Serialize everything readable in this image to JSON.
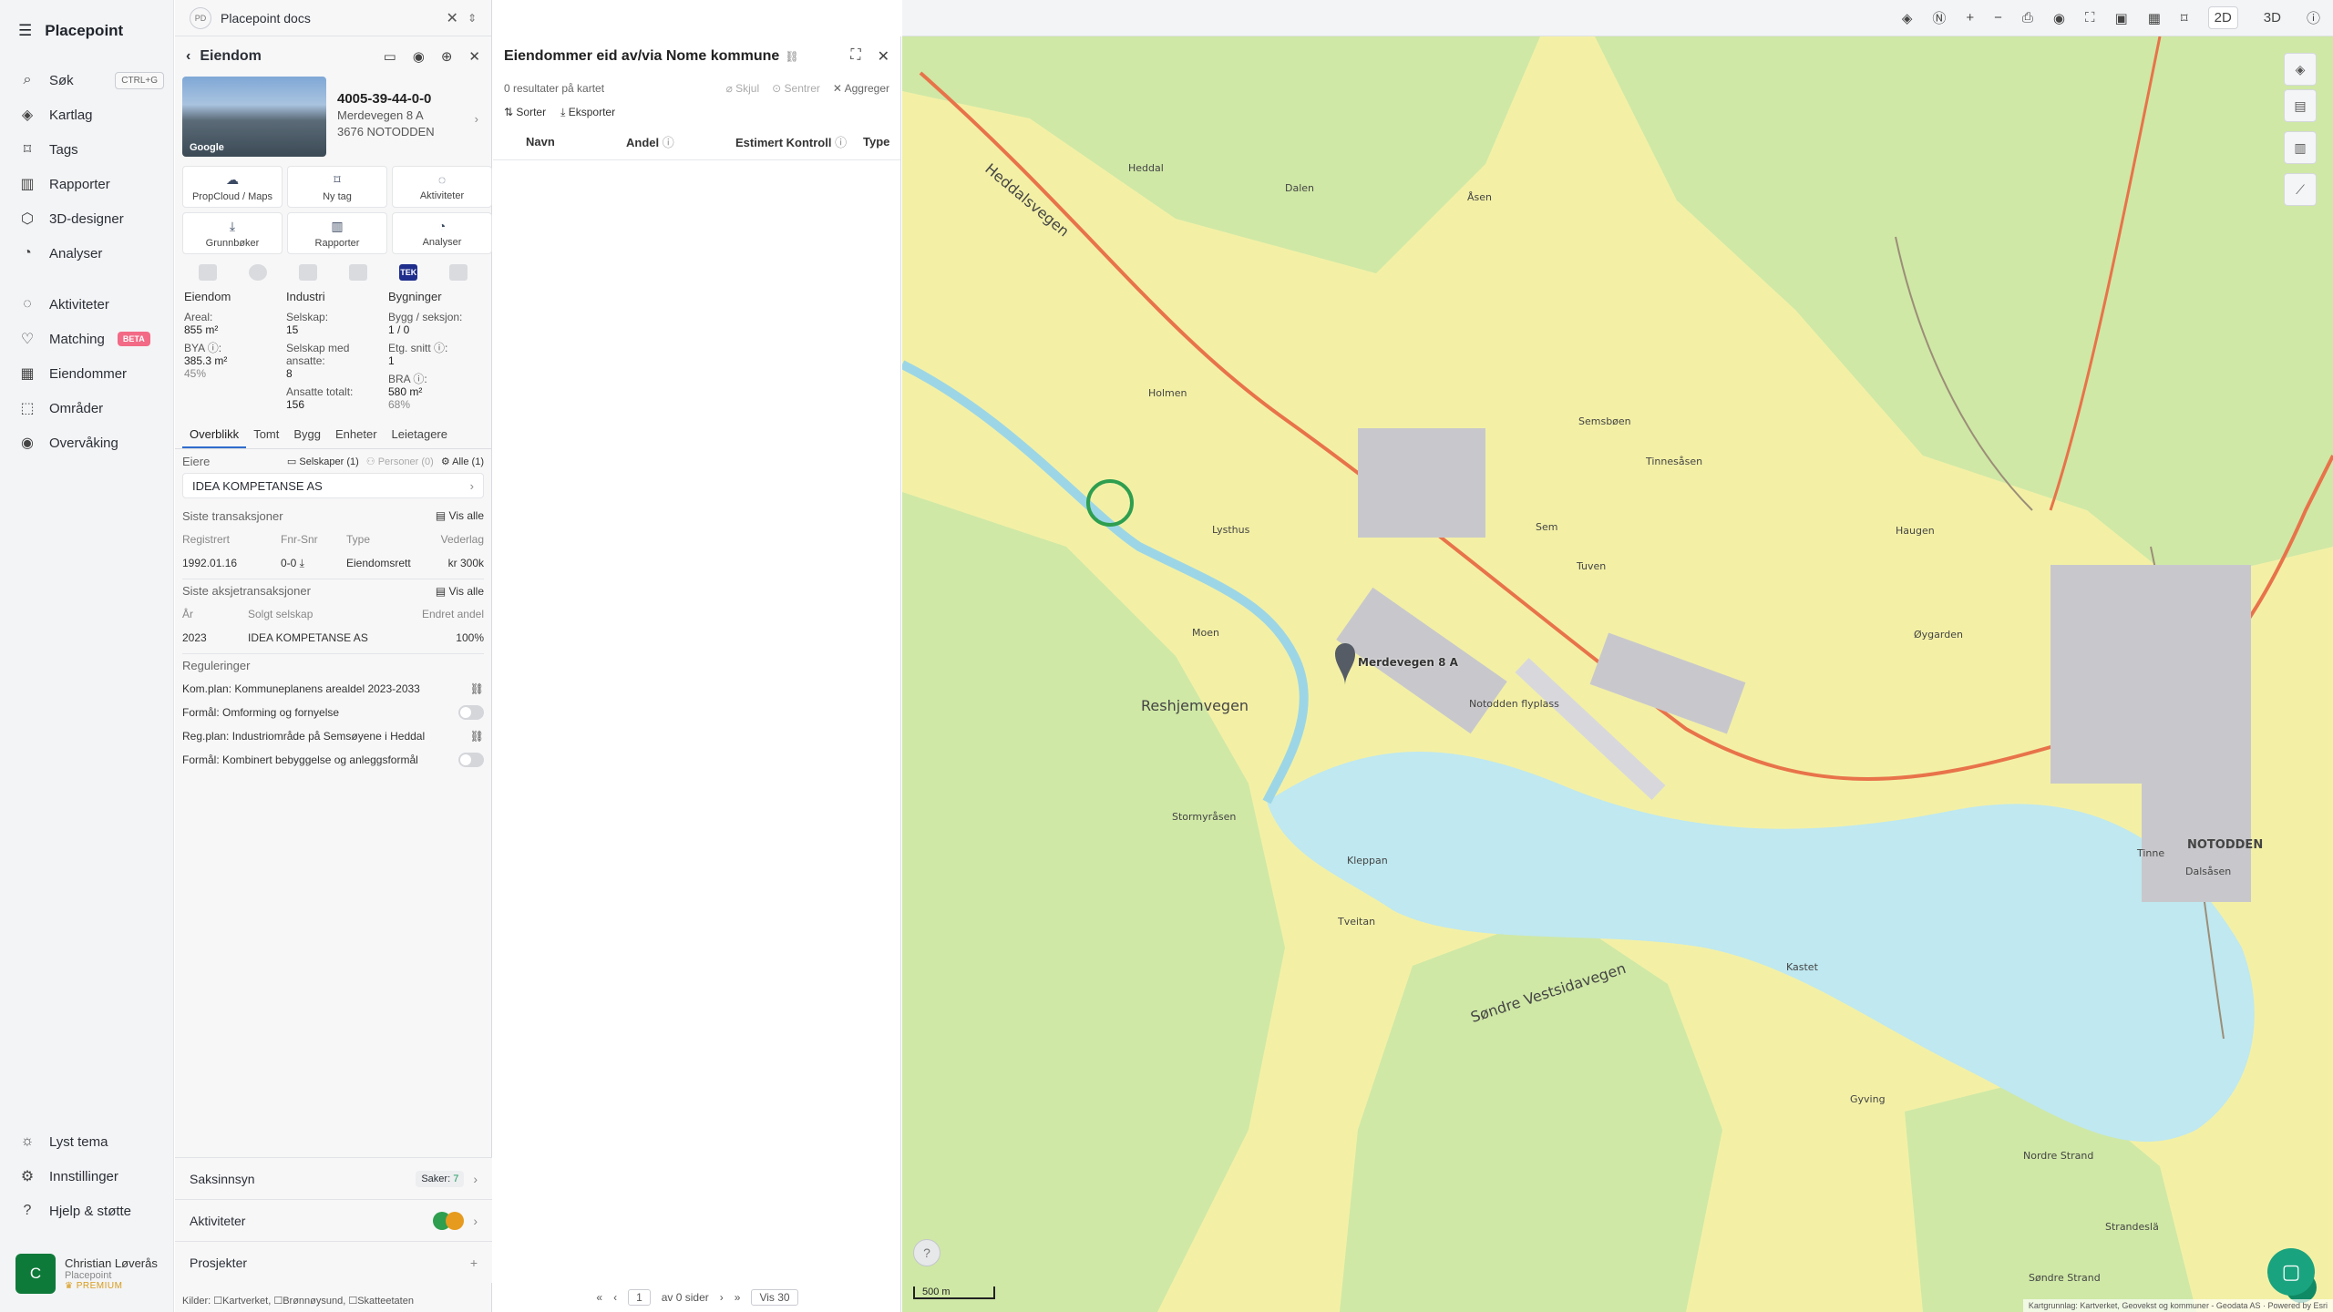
{
  "app": {
    "brand": "Placepoint"
  },
  "nav": {
    "items": [
      {
        "label": "Søk",
        "icon": "search-icon",
        "shortcut": "CTRL+G"
      },
      {
        "label": "Kartlag",
        "icon": "layers-icon"
      },
      {
        "label": "Tags",
        "icon": "bookmark-icon"
      },
      {
        "label": "Rapporter",
        "icon": "chart-icon"
      },
      {
        "label": "3D-designer",
        "icon": "cube-icon"
      },
      {
        "label": "Analyser",
        "icon": "gauge-icon"
      },
      {
        "label": "Aktiviteter",
        "icon": "chat-icon"
      },
      {
        "label": "Matching",
        "icon": "heart-icon",
        "badge": "BETA"
      },
      {
        "label": "Eiendommer",
        "icon": "building-icon"
      },
      {
        "label": "Områder",
        "icon": "area-icon"
      },
      {
        "label": "Overvåking",
        "icon": "check-circle-icon"
      }
    ],
    "bottom": [
      {
        "label": "Lyst tema",
        "icon": "sun-icon"
      },
      {
        "label": "Innstillinger",
        "icon": "gear-icon"
      },
      {
        "label": "Hjelp & støtte",
        "icon": "help-icon"
      }
    ]
  },
  "user": {
    "initial": "C",
    "name": "Christian Løverås",
    "org": "Placepoint",
    "plan": "PREMIUM"
  },
  "docs": {
    "badge": "PD",
    "title": "Placepoint docs"
  },
  "property": {
    "header": "Eiendom",
    "id": "4005-39-44-0-0",
    "address": "Merdevegen 8 A",
    "postal": "3676 NOTODDEN",
    "photo_label": "Google",
    "actions": [
      {
        "label": "PropCloud / Maps",
        "icon": "cloud-icon"
      },
      {
        "label": "Ny tag",
        "icon": "bookmark-icon"
      },
      {
        "label": "Aktiviteter",
        "icon": "chat-icon"
      },
      {
        "label": "Grunnbøker",
        "icon": "download-icon"
      },
      {
        "label": "Rapporter",
        "icon": "chart-icon"
      },
      {
        "label": "Analyser",
        "icon": "gauge-icon"
      }
    ],
    "brand_tek": "TEK",
    "stats": {
      "col1": {
        "title": "Eiendom",
        "areal_label": "Areal:",
        "areal": "855 m²",
        "bya_label": "BYA ⓘ:",
        "bya": "385.3 m²",
        "bya_pct": "45%"
      },
      "col2": {
        "title": "Industri",
        "selskap_label": "Selskap:",
        "selskap": "15",
        "ansatte_label": "Selskap med ansatte:",
        "ansatte": "8",
        "tot_label": "Ansatte totalt:",
        "tot": "156"
      },
      "col3": {
        "title": "Bygninger",
        "bygg_label": "Bygg / seksjon:",
        "bygg": "1 / 0",
        "etg_label": "Etg. snitt ⓘ:",
        "etg": "1",
        "bra_label": "BRA ⓘ:",
        "bra": "580 m²",
        "bra_pct": "68%"
      }
    },
    "tabs": [
      "Overblikk",
      "Tomt",
      "Bygg",
      "Enheter",
      "Leietagere"
    ],
    "owners": {
      "label": "Eiere",
      "f1": "Selskaper (1)",
      "f2": "Personer (0)",
      "f3": "Alle (1)",
      "owner": "IDEA KOMPETANSE AS"
    },
    "tx": {
      "title": "Siste transaksjoner",
      "link": "Vis alle",
      "h": [
        "Registrert",
        "Fnr-Snr",
        "Type",
        "Vederlag"
      ],
      "r": [
        "1992.01.16",
        "0-0",
        "Eiendomsrett",
        "kr 300k"
      ]
    },
    "stx": {
      "title": "Siste aksjetransaksjoner",
      "link": "Vis alle",
      "h": [
        "År",
        "Solgt selskap",
        "Endret andel"
      ],
      "r": [
        "2023",
        "IDEA KOMPETANSE AS",
        "100%"
      ]
    },
    "reg": {
      "title": "Reguleringer",
      "r1": "Kom.plan: Kommuneplanens arealdel 2023-2033",
      "r2": "Formål: Omforming og fornyelse",
      "r3": "Reg.plan: Industriområde på Semsøyene i Heddal",
      "r4": "Formål: Kombinert bebyggelse og anleggsformål"
    },
    "acc": {
      "a1": "Saksinnsyn",
      "a1v": "Saker:",
      "a1n": "7",
      "a2": "Aktiviteter",
      "a3": "Prosjekter"
    },
    "sources": "Kilder: ☐Kartverket, ☐Brønnøysund, ☐Skatteetaten"
  },
  "list": {
    "title": "Eiendommer eid av/via Nome kommune",
    "count": "0 resultater på kartet",
    "skjul": "Skjul",
    "sentrer": "Sentrer",
    "aggreger": "Aggreger",
    "sorter": "Sorter",
    "eksporter": "Eksporter",
    "cols": [
      "Navn",
      "Andel",
      "Estimert Kontroll",
      "Type"
    ],
    "page": "1",
    "of": "av 0 sider",
    "vis": "Vis 30"
  },
  "map": {
    "mode2d": "2D",
    "mode3d": "3D",
    "scale": "500 m",
    "attribution": "Kartgrunnlag: Kartverket, Geovekst og kommuner - Geodata AS · Powered by Esri",
    "labels": [
      "NOTODDEN",
      "Heddal",
      "Holmen",
      "Lysthus",
      "Moen",
      "Notodden flyplass",
      "Tuven",
      "Stormyråsen",
      "Kleppan",
      "Tveitan",
      "Sem",
      "Semsbøen",
      "Tinnesåsen",
      "Haugen",
      "Øygarden",
      "Reshjemvegen",
      "Heddalsvegen",
      "Søndre Vestsidavegen",
      "Merdevegen 8 A",
      "Dalen",
      "Åsen",
      "Kastet",
      "Gyving",
      "Nordre Strand",
      "Søndre Strand",
      "Dalsåsen",
      "Tinne",
      "Strandeslä"
    ]
  },
  "colors": {
    "accent": "#2f6ccc",
    "map_yellow": "#f3f0a6",
    "map_green": "#cfe8a6",
    "water": "#bfe8f0",
    "road": "#e8734a"
  }
}
